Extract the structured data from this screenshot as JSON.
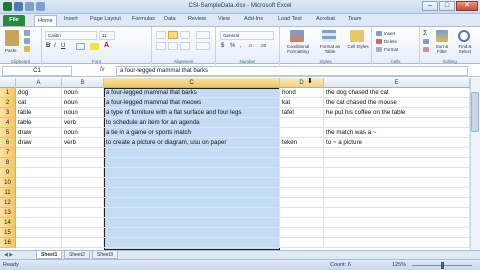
{
  "window": {
    "title": "CSI-SampleData.xlsx - Microsoft Excel"
  },
  "ribbon": {
    "tabs": [
      "File",
      "Home",
      "Insert",
      "Page Layout",
      "Formulas",
      "Data",
      "Review",
      "View",
      "Add-Ins",
      "Load Test",
      "Acrobat",
      "Team"
    ],
    "active_tab": "Home",
    "paste_label": "Paste",
    "font_name": "Calibri",
    "font_size": "11",
    "number_format": "General",
    "conditional_label": "Conditional Formatting",
    "format_table_label": "Format as Table",
    "cell_styles_label": "Cell Styles",
    "insert_label": "Insert",
    "delete_label": "Delete",
    "format_label": "Format",
    "sort_label": "Sort & Filter",
    "find_label": "Find & Select",
    "groups": [
      "Clipboard",
      "Font",
      "Alignment",
      "Number",
      "Styles",
      "Cells",
      "Editing"
    ]
  },
  "formula_bar": {
    "name_box": "C1",
    "fx": "fx",
    "content": "a four-legged mammal that barks"
  },
  "grid": {
    "columns": [
      "A",
      "B",
      "C",
      "D",
      "E"
    ],
    "selected_column": "C",
    "rows": [
      "1",
      "2",
      "3",
      "4",
      "5",
      "6",
      "7",
      "8",
      "9",
      "10",
      "11",
      "12",
      "13",
      "14",
      "15",
      "16"
    ],
    "data": [
      [
        "dog",
        "noun",
        "a four-legged mammal that barks",
        "hond",
        "the dog chased the cat"
      ],
      [
        "cat",
        "noun",
        "a four-legged mammal that meows",
        "kat",
        "the cat chased the mouse"
      ],
      [
        "table",
        "noun",
        "a type of furniture with a flat surface and four legs",
        "tafel",
        "he put his coffee on the table"
      ],
      [
        "table",
        "verb",
        "to schedule an item for an agenda",
        "",
        ""
      ],
      [
        "draw",
        "noun",
        "a tie in a game or sports match",
        "",
        "the match was a ~"
      ],
      [
        "draw",
        "verb",
        "to create a picture or diagram, usu on paper",
        "teken",
        "to ~ a picture"
      ]
    ]
  },
  "sheets": {
    "tabs": [
      "Sheet1",
      "Sheet2",
      "Sheet3"
    ],
    "active": "Sheet1"
  },
  "status": {
    "mode": "Ready",
    "count": "Count: 6",
    "zoom": "125%"
  },
  "colors": {
    "file_tab": "#2a8a3a",
    "selection": "#c5dcf6",
    "header_highlight": "#f6c55d"
  }
}
